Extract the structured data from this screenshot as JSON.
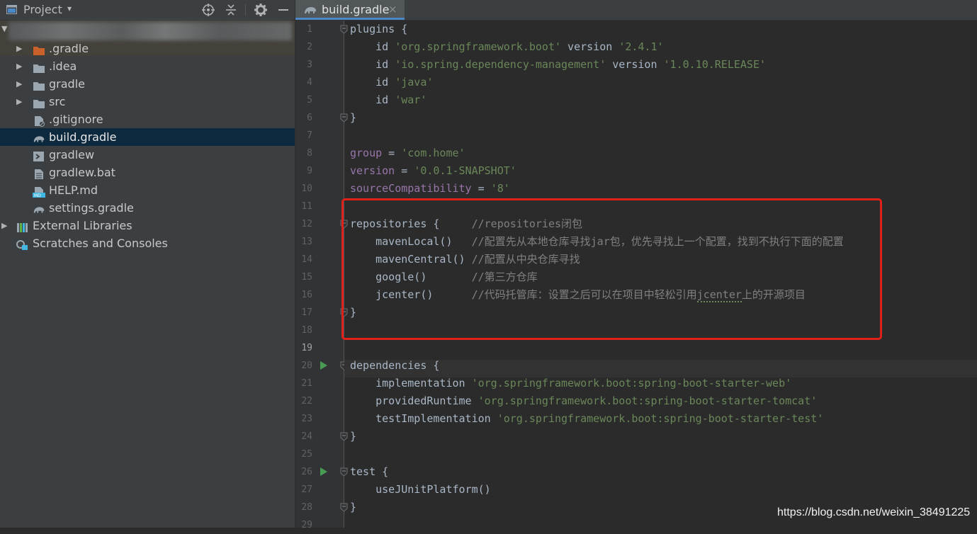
{
  "project_panel": {
    "title": "Project",
    "dropdown_glyph": "▾",
    "header_icons": [
      "locate-icon",
      "collapse-all-icon",
      "gear-icon",
      "hide-icon"
    ],
    "root_label_obscured": true,
    "tree": [
      {
        "label": ".gradle",
        "icon": "folder-orange-icon",
        "expandable": true
      },
      {
        "label": ".idea",
        "icon": "folder-icon",
        "expandable": true
      },
      {
        "label": "gradle",
        "icon": "folder-icon",
        "expandable": true
      },
      {
        "label": "src",
        "icon": "folder-icon",
        "expandable": true
      },
      {
        "label": ".gitignore",
        "icon": "gitignore-file-icon",
        "expandable": false
      },
      {
        "label": "build.gradle",
        "icon": "gradle-elephant-icon",
        "expandable": false,
        "selected": true
      },
      {
        "label": "gradlew",
        "icon": "terminal-file-icon",
        "expandable": false
      },
      {
        "label": "gradlew.bat",
        "icon": "text-file-icon",
        "expandable": false
      },
      {
        "label": "HELP.md",
        "icon": "markdown-file-icon",
        "expandable": false
      },
      {
        "label": "settings.gradle",
        "icon": "gradle-elephant-icon",
        "expandable": false
      },
      {
        "label": "External Libraries",
        "icon": "library-icon",
        "expandable": true
      },
      {
        "label": "Scratches and Consoles",
        "icon": "scratches-icon",
        "expandable": false
      }
    ]
  },
  "editor": {
    "tab": {
      "label": "build.gradle",
      "close": "×"
    },
    "line_numbers": [
      "1",
      "2",
      "3",
      "4",
      "5",
      "6",
      "7",
      "8",
      "9",
      "10",
      "11",
      "12",
      "13",
      "14",
      "15",
      "16",
      "17",
      "18",
      "19",
      "20",
      "21",
      "22",
      "23",
      "24",
      "25",
      "26",
      "27",
      "28",
      "29"
    ],
    "current_line": "19",
    "code": {
      "l1_kw": "plugins {",
      "l2_a": "    id ",
      "l2_b": "'org.springframework.boot'",
      "l2_c": " version ",
      "l2_d": "'2.4.1'",
      "l3_a": "    id ",
      "l3_b": "'io.spring.dependency-management'",
      "l3_c": " version ",
      "l3_d": "'1.0.10.RELEASE'",
      "l4_a": "    id ",
      "l4_b": "'java'",
      "l5_a": "    id ",
      "l5_b": "'war'",
      "l6": "}",
      "l8_a": "group",
      "l8_b": " = ",
      "l8_c": "'com.home'",
      "l9_a": "version",
      "l9_b": " = ",
      "l9_c": "'0.0.1-SNAPSHOT'",
      "l10_a": "sourceCompatibility",
      "l10_b": " = ",
      "l10_c": "'8'",
      "l12_a": "repositories {     ",
      "l12_b": "//repositories闭包",
      "l13_a": "    mavenLocal()   ",
      "l13_b": "//配置先从本地仓库寻找jar包，优先寻找上一个配置，找到不执行下面的配置",
      "l14_a": "    mavenCentral() ",
      "l14_b": "//配置从中央仓库寻找",
      "l15_a": "    google()       ",
      "l15_b": "//第三方仓库",
      "l16_a": "    jcenter()      ",
      "l16_b1": "//代码托管库：设置之后可以在项目中轻松引用",
      "l16_b2": "jcenter",
      "l16_b3": "上的开源项目",
      "l17": "}",
      "l20": "dependencies {",
      "l21_a": "    implementation ",
      "l21_b": "'org.springframework.boot:spring-boot-starter-web'",
      "l22_a": "    providedRuntime ",
      "l22_b": "'org.springframework.boot:spring-boot-starter-tomcat'",
      "l23_a": "    testImplementation ",
      "l23_b": "'org.springframework.boot:spring-boot-starter-test'",
      "l24": "}",
      "l26": "test {",
      "l27": "    useJUnitPlatform()",
      "l28": "}"
    },
    "run_gutter_lines": [
      "20",
      "26"
    ]
  },
  "watermark": "https://blog.csdn.net/weixin_38491225",
  "colors": {
    "string": "#6a8759",
    "comment": "#808080",
    "property": "#9876aa",
    "highlight_box": "#e0201a",
    "selection": "#0d293e",
    "run_marker": "#499c54"
  }
}
